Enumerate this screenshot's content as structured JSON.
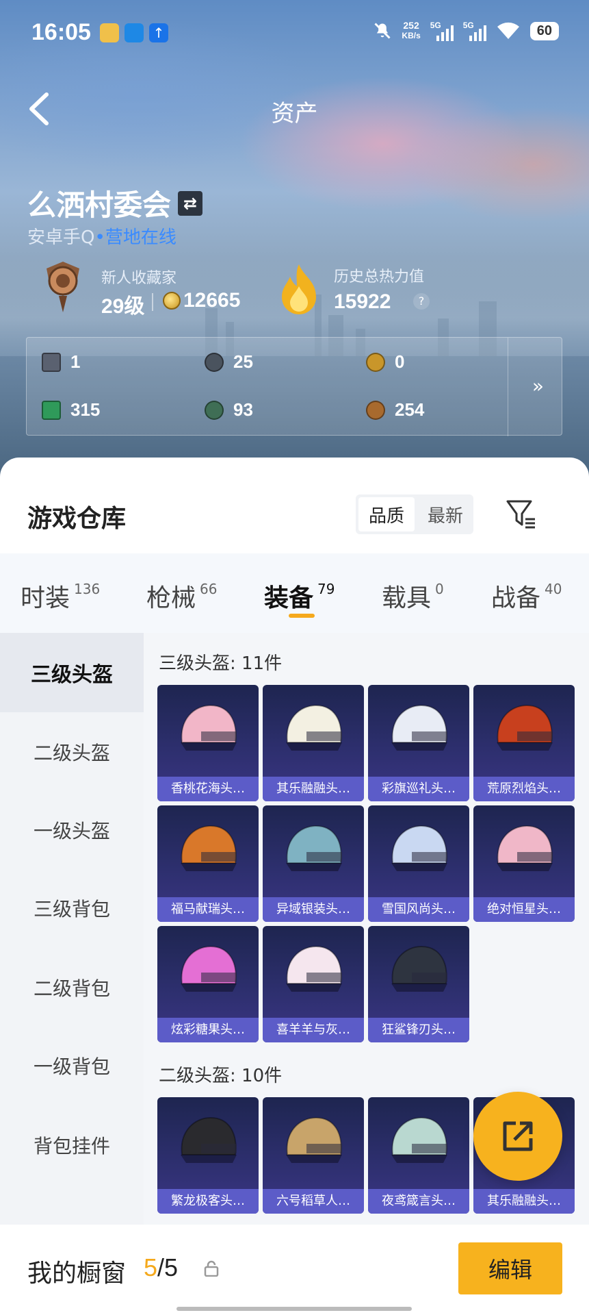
{
  "status_bar": {
    "time": "16:05",
    "net_speed_value": "252",
    "net_speed_unit": "KB/s",
    "sim1": "5G",
    "sim2": "5G",
    "battery": "60"
  },
  "header": {
    "title": "资产"
  },
  "profile": {
    "name": "么洒村委会",
    "platform": "安卓手Q",
    "status": "营地在线",
    "rank_title": "新人收藏家",
    "level": "29级",
    "points": "12665",
    "heat_title": "历史总热力值",
    "heat_value": "15922",
    "heat_help": "?"
  },
  "currencies": [
    {
      "icon": "card-ticket-icon",
      "value": "1",
      "color": "#5a6170"
    },
    {
      "icon": "silver-coin-icon",
      "value": "25",
      "color": "#4a535e"
    },
    {
      "icon": "gold-coin-icon",
      "value": "0",
      "color": "#c9962a"
    },
    {
      "icon": "green-ticket-icon",
      "value": "315",
      "color": "#2f9a5a"
    },
    {
      "icon": "jade-coin-icon",
      "value": "93",
      "color": "#3f6e55"
    },
    {
      "icon": "bronze-coin-icon",
      "value": "254",
      "color": "#a86a2e"
    }
  ],
  "warehouse": {
    "title": "游戏仓库",
    "sort_options": [
      "品质",
      "最新"
    ],
    "sort_selected": "品质"
  },
  "tabs": [
    {
      "label": "时装",
      "count": "136"
    },
    {
      "label": "枪械",
      "count": "66"
    },
    {
      "label": "装备",
      "count": "79",
      "active": true
    },
    {
      "label": "载具",
      "count": "0"
    },
    {
      "label": "战备",
      "count": "40"
    }
  ],
  "categories": [
    "三级头盔",
    "二级头盔",
    "一级头盔",
    "三级背包",
    "二级背包",
    "一级背包",
    "背包挂件"
  ],
  "active_category": "三级头盔",
  "sections": [
    {
      "title": "三级头盔: 11件",
      "items": [
        {
          "name": "香桃花海头…",
          "color": "#f2b6c8"
        },
        {
          "name": "其乐融融头…",
          "color": "#f3f0e2"
        },
        {
          "name": "彩旗巡礼头…",
          "color": "#e8ecf5"
        },
        {
          "name": "荒原烈焰头…",
          "color": "#c8401e"
        },
        {
          "name": "福马献瑞头…",
          "color": "#d9782a"
        },
        {
          "name": "异域银装头…",
          "color": "#7fb2c2"
        },
        {
          "name": "雪国风尚头…",
          "color": "#c9d8f2"
        },
        {
          "name": "绝对恒星头…",
          "color": "#f0b7c8"
        },
        {
          "name": "炫彩糖果头…",
          "color": "#e46fd4"
        },
        {
          "name": "喜羊羊与灰…",
          "color": "#f5e6ee"
        },
        {
          "name": "狂鲨锋刃头…",
          "color": "#2e3440"
        }
      ]
    },
    {
      "title": "二级头盔: 10件",
      "items": [
        {
          "name": "繁龙极客头…",
          "color": "#2a2a2e"
        },
        {
          "name": "六号稻草人…",
          "color": "#c8a46a"
        },
        {
          "name": "夜鸢箴言头…",
          "color": "#b9d8d0"
        },
        {
          "name": "其乐融融头…",
          "color": "#f3f0e2"
        }
      ]
    }
  ],
  "bottom": {
    "showcase_label": "我的橱窗",
    "showcase_current": "5",
    "showcase_total": "/5",
    "edit_label": "编辑"
  }
}
